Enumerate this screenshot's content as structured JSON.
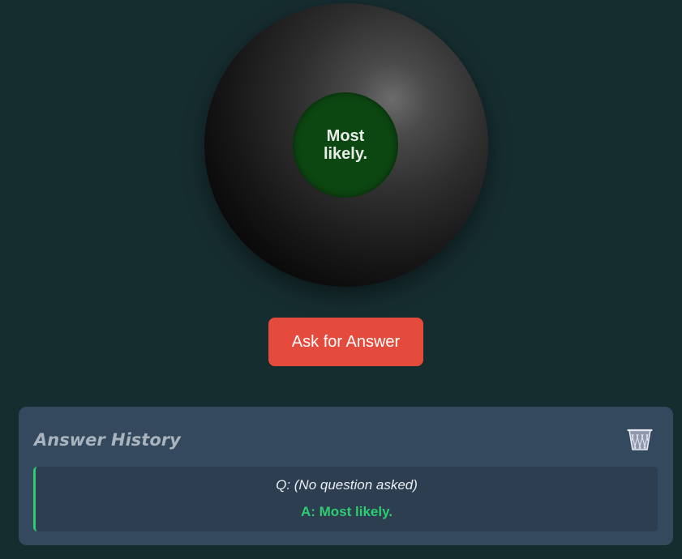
{
  "eight_ball": {
    "answer": "Most likely."
  },
  "ask_button": {
    "label": "Ask for Answer"
  },
  "history": {
    "title": "Answer History",
    "clear_icon": "wastebasket-icon",
    "entries": [
      {
        "question": "Q: (No question asked)",
        "answer": "A: Most likely."
      }
    ]
  },
  "colors": {
    "background": "#162d30",
    "ball_window": "#0c4610",
    "button": "#e54b3c",
    "panel": "#34495e",
    "entry": "#2c3e50",
    "answer_accent": "#2ecc71"
  }
}
